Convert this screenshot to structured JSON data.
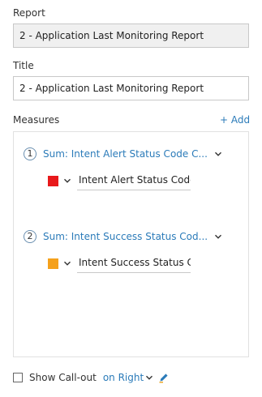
{
  "report": {
    "label": "Report",
    "value": "2 - Application Last Monitoring Report"
  },
  "title": {
    "label": "Title",
    "value": "2 - Application Last Monitoring Report"
  },
  "measures": {
    "label": "Measures",
    "add_label": "+ Add",
    "items": [
      {
        "number": "1",
        "title": "Sum: Intent Alert Status Code C...",
        "color": "#e8191b",
        "input_value": "Intent Alert Status Code C"
      },
      {
        "number": "2",
        "title": "Sum: Intent Success Status Cod...",
        "color": "#f5a11c",
        "input_value": "Intent Success Status Cod"
      }
    ]
  },
  "callout": {
    "label": "Show Call-out",
    "position": "on Right"
  },
  "colors": {
    "accent": "#2b7bb9",
    "border": "#c8c8c8"
  }
}
